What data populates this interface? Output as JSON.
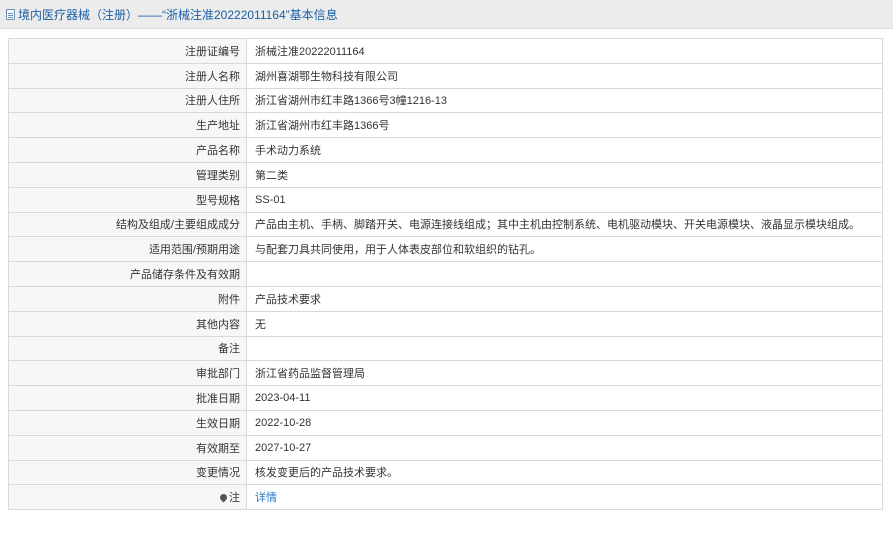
{
  "header": {
    "icon": "document-icon",
    "title": "境内医疗器械（注册）——“浙械注准20222011164”基本信息"
  },
  "rows": [
    {
      "key": "registration-number",
      "label": "注册证编号",
      "value": "浙械注准20222011164"
    },
    {
      "key": "registrant-name",
      "label": "注册人名称",
      "value": "湖州喜湖鄂生物科技有限公司"
    },
    {
      "key": "registrant-address",
      "label": "注册人住所",
      "value": "浙江省湖州市红丰路1366号3幢1216-13"
    },
    {
      "key": "production-address",
      "label": "生产地址",
      "value": "浙江省湖州市红丰路1366号"
    },
    {
      "key": "product-name",
      "label": "产品名称",
      "value": "手术动力系统"
    },
    {
      "key": "management-class",
      "label": "管理类别",
      "value": "第二类"
    },
    {
      "key": "model-spec",
      "label": "型号规格",
      "value": "SS-01"
    },
    {
      "key": "structure-composition",
      "label": "结构及组成/主要组成成分",
      "value": "产品由主机、手柄、脚踏开关、电源连接线组成；其中主机由控制系统、电机驱动模块、开关电源模块、液晶显示模块组成。"
    },
    {
      "key": "intended-use",
      "label": "适用范围/预期用途",
      "value": "与配套刀具共同使用，用于人体表皮部位和软组织的钻孔。"
    },
    {
      "key": "storage-conditions",
      "label": "产品储存条件及有效期",
      "value": ""
    },
    {
      "key": "attachment",
      "label": "附件",
      "value": "产品技术要求"
    },
    {
      "key": "other-content",
      "label": "其他内容",
      "value": "无"
    },
    {
      "key": "remarks",
      "label": "备注",
      "value": ""
    },
    {
      "key": "approval-department",
      "label": "审批部门",
      "value": "浙江省药品监督管理局"
    },
    {
      "key": "approval-date",
      "label": "批准日期",
      "value": "2023-04-11"
    },
    {
      "key": "effective-date",
      "label": "生效日期",
      "value": "2022-10-28"
    },
    {
      "key": "expiry-date",
      "label": "有效期至",
      "value": "2027-10-27"
    },
    {
      "key": "change-status",
      "label": "变更情况",
      "value": "核发变更后的产品技术要求。"
    }
  ],
  "note_row": {
    "icon": "pin-icon",
    "label": "注",
    "link_text": "详情"
  },
  "colors": {
    "header_bg": "#ececec",
    "title": "#1a5fa6",
    "link": "#2a78c6",
    "border": "#d9d9d9"
  }
}
